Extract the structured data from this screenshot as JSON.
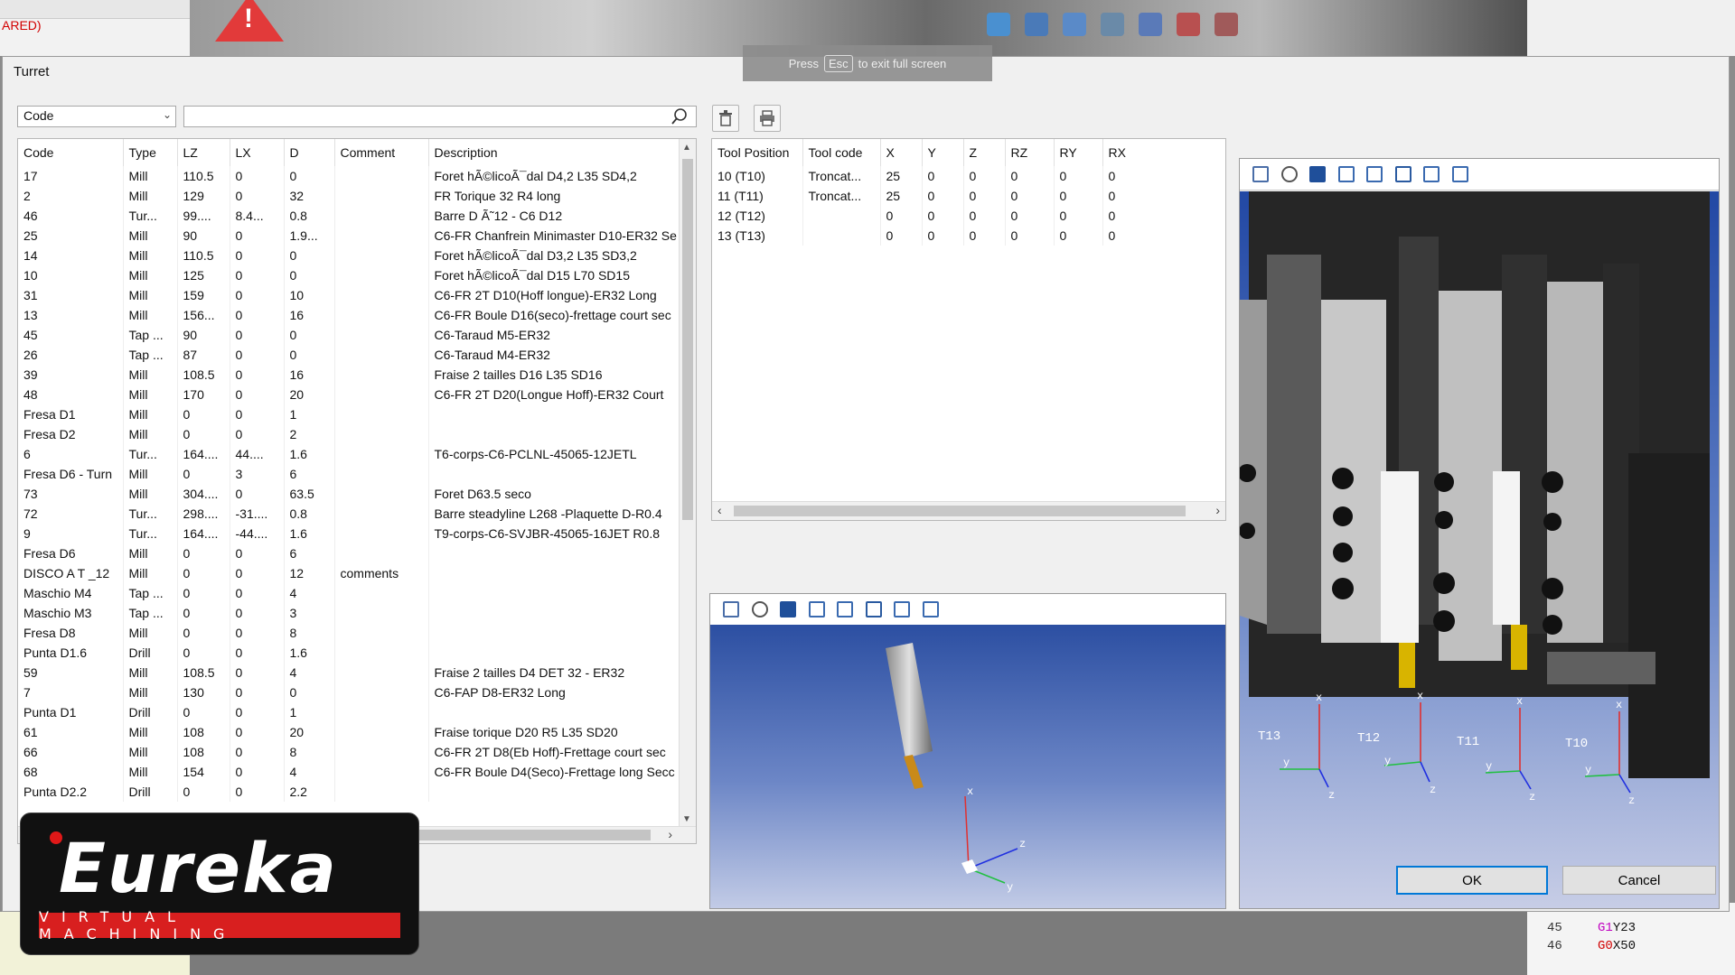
{
  "background": {
    "left_text": "ARED)",
    "fullscreen_banner": {
      "prefix": "Press",
      "key": "Esc",
      "suffix": "to exit full screen"
    },
    "code_lines": [
      {
        "num": "45",
        "code": "G1",
        "rest": "Y23"
      },
      {
        "num": "46",
        "code": "G0",
        "rest": "X50"
      }
    ]
  },
  "dialog": {
    "title": "Turret",
    "filter": {
      "selected": "Code",
      "search_value": "",
      "search_placeholder": ""
    },
    "delete_icon": "trash-icon",
    "print_icon": "printer-icon",
    "tools": {
      "columns": [
        "Code",
        "Type",
        "LZ",
        "LX",
        "D",
        "Comment",
        "Description"
      ],
      "rows": [
        [
          "17",
          "Mill",
          "110.5",
          "0",
          "0",
          "",
          "Foret hÃ©licoÃ¯dal D4,2 L35 SD4,2"
        ],
        [
          "2",
          "Mill",
          "129",
          "0",
          "32",
          "",
          "FR Torique 32 R4 long"
        ],
        [
          "46",
          "Tur...",
          "99....",
          "8.4...",
          "0.8",
          "",
          "Barre D Ã˜12 - C6 D12"
        ],
        [
          "25",
          "Mill",
          "90",
          "0",
          "1.9...",
          "",
          "C6-FR Chanfrein Minimaster D10-ER32 Se"
        ],
        [
          "14",
          "Mill",
          "110.5",
          "0",
          "0",
          "",
          "Foret hÃ©licoÃ¯dal D3,2 L35 SD3,2"
        ],
        [
          "10",
          "Mill",
          "125",
          "0",
          "0",
          "",
          "Foret hÃ©licoÃ¯dal D15 L70 SD15"
        ],
        [
          "31",
          "Mill",
          "159",
          "0",
          "10",
          "",
          "C6-FR 2T D10(Hoff longue)-ER32 Long"
        ],
        [
          "13",
          "Mill",
          "156...",
          "0",
          "16",
          "",
          "C6-FR Boule D16(seco)-frettage court sec"
        ],
        [
          "45",
          "Tap ...",
          "90",
          "0",
          "0",
          "",
          "C6-Taraud M5-ER32"
        ],
        [
          "26",
          "Tap ...",
          "87",
          "0",
          "0",
          "",
          "C6-Taraud M4-ER32"
        ],
        [
          "39",
          "Mill",
          "108.5",
          "0",
          "16",
          "",
          "Fraise 2 tailles D16 L35 SD16"
        ],
        [
          "48",
          "Mill",
          "170",
          "0",
          "20",
          "",
          "C6-FR 2T D20(Longue Hoff)-ER32 Court"
        ],
        [
          "Fresa D1",
          "Mill",
          "0",
          "0",
          "1",
          "",
          ""
        ],
        [
          "Fresa D2",
          "Mill",
          "0",
          "0",
          "2",
          "",
          ""
        ],
        [
          "6",
          "Tur...",
          "164....",
          "44....",
          "1.6",
          "",
          "T6-corps-C6-PCLNL-45065-12JETL"
        ],
        [
          "Fresa D6 - Turn",
          "Mill",
          "0",
          "3",
          "6",
          "",
          ""
        ],
        [
          "73",
          "Mill",
          "304....",
          "0",
          "63.5",
          "",
          "Foret D63.5 seco"
        ],
        [
          "72",
          "Tur...",
          "298....",
          "-31....",
          "0.8",
          "",
          "Barre steadyline L268 -Plaquette D-R0.4"
        ],
        [
          "9",
          "Tur...",
          "164....",
          "-44....",
          "1.6",
          "",
          "T9-corps-C6-SVJBR-45065-16JET R0.8"
        ],
        [
          "Fresa D6",
          "Mill",
          "0",
          "0",
          "6",
          "",
          ""
        ],
        [
          "DISCO A T _12",
          "Mill",
          "0",
          "0",
          "12",
          "comments",
          ""
        ],
        [
          "Maschio M4",
          "Tap ...",
          "0",
          "0",
          "4",
          "",
          ""
        ],
        [
          "Maschio M3",
          "Tap ...",
          "0",
          "0",
          "3",
          "",
          ""
        ],
        [
          "Fresa D8",
          "Mill",
          "0",
          "0",
          "8",
          "",
          ""
        ],
        [
          "Punta D1.6",
          "Drill",
          "0",
          "0",
          "1.6",
          "",
          ""
        ],
        [
          "59",
          "Mill",
          "108.5",
          "0",
          "4",
          "",
          "Fraise 2 tailles D4 DET 32 - ER32"
        ],
        [
          "7",
          "Mill",
          "130",
          "0",
          "0",
          "",
          "C6-FAP D8-ER32 Long"
        ],
        [
          "Punta D1",
          "Drill",
          "0",
          "0",
          "1",
          "",
          ""
        ],
        [
          "61",
          "Mill",
          "108",
          "0",
          "20",
          "",
          "Fraise torique D20 R5 L35 SD20"
        ],
        [
          "66",
          "Mill",
          "108",
          "0",
          "8",
          "",
          "C6-FR 2T D8(Eb Hoff)-Frettage court sec"
        ],
        [
          "68",
          "Mill",
          "154",
          "0",
          "4",
          "",
          "C6-FR Boule D4(Seco)-Frettage long Secc"
        ],
        [
          "Punta D2.2",
          "Drill",
          "0",
          "0",
          "2.2",
          "",
          ""
        ]
      ]
    },
    "positions": {
      "columns": [
        "Tool Position",
        "Tool code",
        "X",
        "Y",
        "Z",
        "RZ",
        "RY",
        "RX"
      ],
      "rows": [
        [
          "10  (T10)",
          "Troncat...",
          "25",
          "0",
          "0",
          "0",
          "0",
          "0"
        ],
        [
          "11  (T11)",
          "Troncat...",
          "25",
          "0",
          "0",
          "0",
          "0",
          "0"
        ],
        [
          "12  (T12)",
          "",
          "0",
          "0",
          "0",
          "0",
          "0",
          "0"
        ],
        [
          "13  (T13)",
          "",
          "0",
          "0",
          "0",
          "0",
          "0",
          "0"
        ]
      ]
    },
    "view_toolbar_icons": [
      "fit-view-icon",
      "zoom-icon",
      "iso-view-icon",
      "front-view-icon",
      "top-view-icon",
      "side-view-icon",
      "back-view-icon",
      "bottom-view-icon"
    ],
    "axis_labels": {
      "x": "x",
      "y": "y",
      "z": "z"
    },
    "turret_labels": [
      "T13",
      "T12",
      "T11",
      "T10"
    ],
    "ok_label": "OK",
    "cancel_label": "Cancel"
  },
  "logo": {
    "word": "Eureka",
    "sub": "VIRTUAL MACHINING"
  }
}
